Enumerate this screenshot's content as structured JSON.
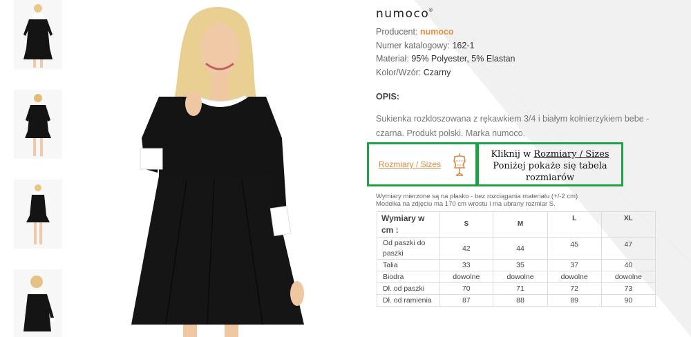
{
  "brand": {
    "logo": "NUMOCO",
    "reg": "®"
  },
  "product": {
    "producer_label": "Producent:",
    "producer": "numoco",
    "catalog_label": "Numer katalogowy:",
    "catalog": "162-1",
    "material_label": "Materiał:",
    "material": "95% Polyester, 5% Elastan",
    "color_label": "Kolor/Wzór:",
    "color": "Czarny"
  },
  "description": {
    "title": "OPIS:",
    "text": "Sukienka rozkloszowana z rękawkiem 3/4 i białym kołnierzykiem bebe - czarna. Produkt polski. Marka numoco."
  },
  "sizes": {
    "link_label": "Rozmiary / Sizes",
    "hint_prefix": "Kliknij w ",
    "hint_link": "Rozmiary / Sizes",
    "hint_line2": "Poniżej pokaże się tabela",
    "hint_line3": "rozmiarów",
    "note_line1": "Wymiary mierzone są na płasko - bez rozciągania materiału (+/-2 cm)",
    "note_line2": "Modelka na zdjęciu ma 170 cm wrostu i ma ubrany rozmiar S."
  },
  "size_table": {
    "header": [
      "Wymiary w cm :",
      "S",
      "M",
      "L",
      "XL"
    ],
    "rows": [
      [
        "Od paszki do paszki",
        "42",
        "44",
        "45",
        "47"
      ],
      [
        "Talia",
        "33",
        "35",
        "37",
        "40"
      ],
      [
        "Biodra",
        "dowolne",
        "dowolne",
        "dowolne",
        "dowolne"
      ],
      [
        "Dł. od paszki",
        "70",
        "71",
        "72",
        "73"
      ],
      [
        "Dł. od ramienia",
        "87",
        "88",
        "89",
        "90"
      ]
    ]
  },
  "icons": {
    "sizes": "mannequin-icon"
  },
  "colors": {
    "accent": "#e38f3f",
    "highlight_border": "#1ea246",
    "dress": "#141414"
  }
}
